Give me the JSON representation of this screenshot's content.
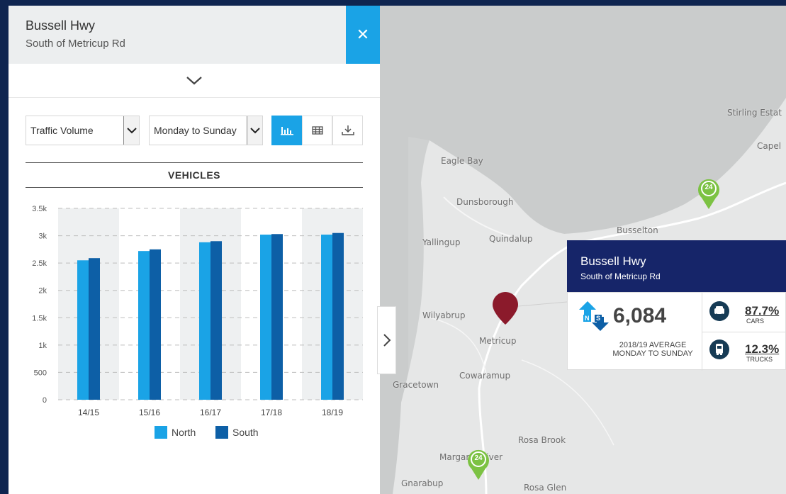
{
  "panel": {
    "title": "Bussell Hwy",
    "subtitle": "South of Metricup Rd",
    "close_icon": "✕"
  },
  "controls": {
    "metric_select": "Traffic Volume",
    "period_select": "Monday to Sunday"
  },
  "chart_data": {
    "type": "bar",
    "title": "VEHICLES",
    "categories": [
      "14/15",
      "15/16",
      "16/17",
      "17/18",
      "18/19"
    ],
    "series": [
      {
        "name": "North",
        "values": [
          2550,
          2720,
          2880,
          3020,
          3020
        ],
        "color": "#1aa3e6"
      },
      {
        "name": "South",
        "values": [
          2590,
          2750,
          2900,
          3030,
          3050
        ],
        "color": "#0d5fa6"
      }
    ],
    "ylim": [
      0,
      3500
    ],
    "yticks": [
      0,
      500,
      1000,
      1500,
      2000,
      2500,
      3000,
      3500
    ],
    "ytick_labels": [
      "0",
      "500",
      "1k",
      "1.5k",
      "2k",
      "2.5k",
      "3k",
      "3.5k"
    ],
    "legend_position": "bottom",
    "grid": true
  },
  "map": {
    "labels": {
      "stirling": "Stirling Estat",
      "capel": "Capel",
      "eagle_bay": "Eagle Bay",
      "dunsborough": "Dunsborough",
      "busselton": "Busselton",
      "yallingup": "Yallingup",
      "quindalup": "Quindalup",
      "wilyabrup": "Wilyabrup",
      "metricup": "Metricup",
      "cowaramup": "Cowaramup",
      "gracetown": "Gracetown",
      "rosa_brook": "Rosa Brook",
      "margaret_river": "Margaret River",
      "gnarabup": "Gnarabup",
      "rosa_glen": "Rosa Glen"
    },
    "badge_text": "24"
  },
  "popup": {
    "title": "Bussell Hwy",
    "subtitle": "South of Metricup Rd",
    "count": "6,084",
    "caption_line1": "2018/19 AVERAGE",
    "caption_line2": "MONDAY TO SUNDAY",
    "cars_pct": "87.7%",
    "cars_label": "CARS",
    "trucks_pct": "12.3%",
    "trucks_label": "TRUCKS",
    "direction_n": "N",
    "direction_s": "S"
  },
  "colors": {
    "accent": "#1aa3e6",
    "north": "#1aa3e6",
    "south": "#0d5fa6",
    "popup_header": "#162569",
    "marker": "#8b1a2b",
    "badge": "#7cc243"
  }
}
